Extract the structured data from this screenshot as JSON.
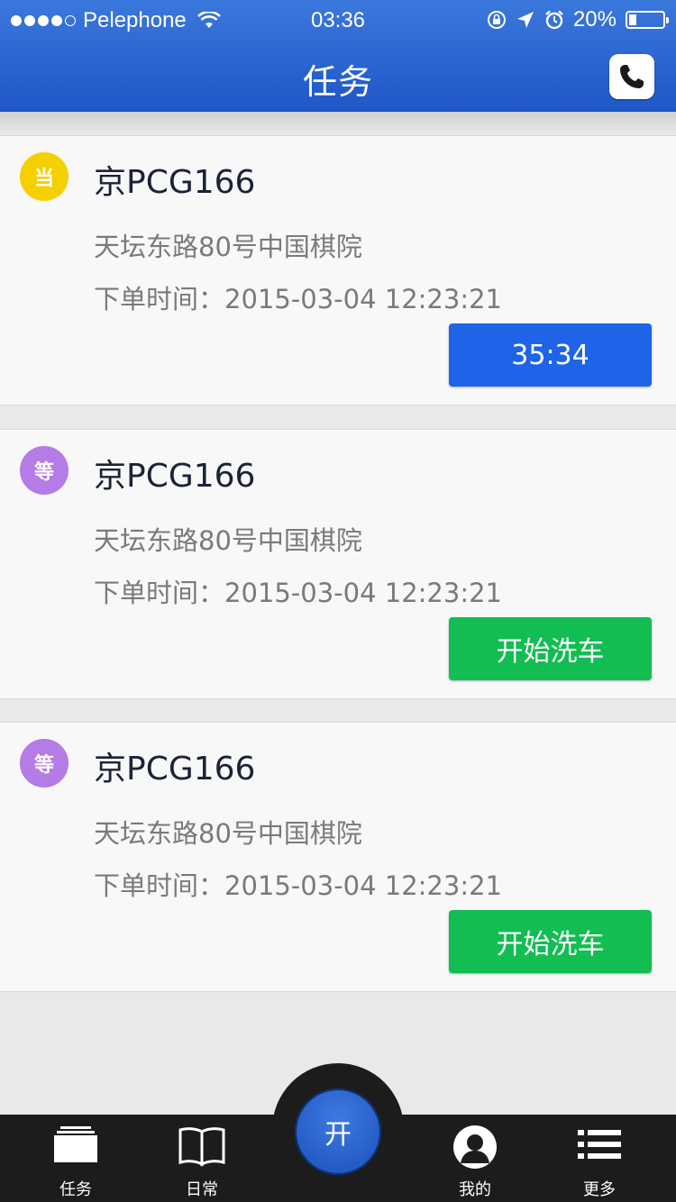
{
  "status_bar": {
    "carrier": "Pelephone",
    "time": "03:36",
    "battery": "20%",
    "signal_dots": 5,
    "signal_filled": 4
  },
  "nav": {
    "title": "任务"
  },
  "tasks": [
    {
      "badge": "当",
      "badge_color": "#f5d000",
      "plate": "京PCG166",
      "address": "天坛东路80号中国棋院",
      "order_time": "下单时间：2015-03-04 12:23:21",
      "action_label": "35:34",
      "action_color": "#1e63e8"
    },
    {
      "badge": "等",
      "badge_color": "#b57be6",
      "plate": "京PCG166",
      "address": "天坛东路80号中国棋院",
      "order_time": "下单时间：2015-03-04 12:23:21",
      "action_label": "开始洗车",
      "action_color": "#12bd52"
    },
    {
      "badge": "等",
      "badge_color": "#b57be6",
      "plate": "京PCG166",
      "address": "天坛东路80号中国棋院",
      "order_time": "下单时间：2015-03-04 12:23:21",
      "action_label": "开始洗车",
      "action_color": "#12bd52"
    }
  ],
  "tab_bar": {
    "center_label": "开",
    "tabs": [
      {
        "label": "任务",
        "icon": "cards-icon"
      },
      {
        "label": "日常",
        "icon": "book-icon"
      },
      {
        "label": "我的",
        "icon": "user-icon"
      },
      {
        "label": "更多",
        "icon": "list-icon"
      }
    ]
  },
  "colors": {
    "header_blue": "#2a63d2",
    "tab_bar": "#1c1c1c"
  }
}
